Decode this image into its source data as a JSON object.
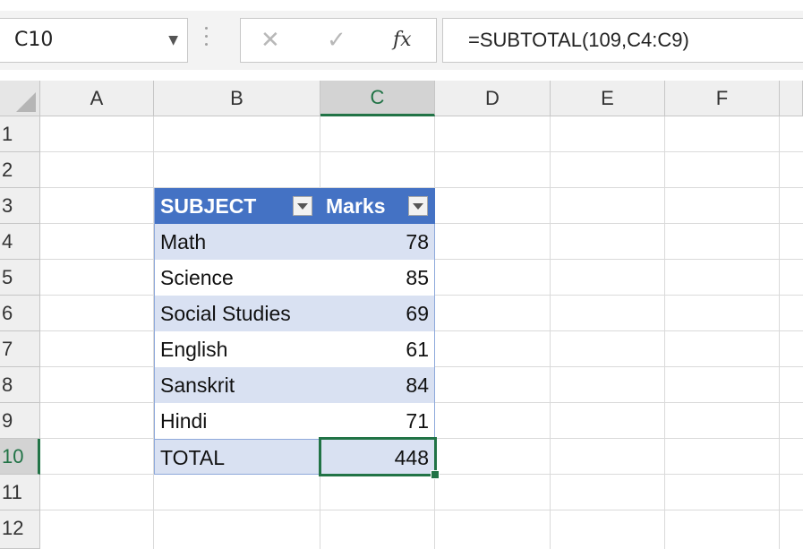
{
  "formula_bar": {
    "name_box": "C10",
    "cancel_glyph": "✕",
    "enter_glyph": "✓",
    "fx_label": "fx",
    "formula": "=SUBTOTAL(109,C4:C9)"
  },
  "columns": [
    "A",
    "B",
    "C",
    "D",
    "E",
    "F"
  ],
  "rows": [
    "1",
    "2",
    "3",
    "4",
    "5",
    "6",
    "7",
    "8",
    "9",
    "10",
    "11",
    "12"
  ],
  "active": {
    "column": "C",
    "row": "10"
  },
  "table": {
    "headers": {
      "subject": "SUBJECT",
      "marks": "Marks"
    },
    "rows": [
      {
        "subject": "Math",
        "marks": "78"
      },
      {
        "subject": "Science",
        "marks": "85"
      },
      {
        "subject": "Social Studies",
        "marks": "69"
      },
      {
        "subject": "English",
        "marks": "61"
      },
      {
        "subject": "Sanskrit",
        "marks": "84"
      },
      {
        "subject": "Hindi",
        "marks": "71"
      }
    ],
    "total": {
      "subject": "TOTAL",
      "marks": "448"
    }
  },
  "colors": {
    "header_fill": "#4472c4",
    "band_fill": "#d9e1f2",
    "selection": "#217346"
  },
  "icons": [
    "dropdown-arrow-icon",
    "cancel-icon",
    "enter-check-icon",
    "function-icon",
    "filter-dropdown-icon",
    "select-all-corner-icon"
  ]
}
